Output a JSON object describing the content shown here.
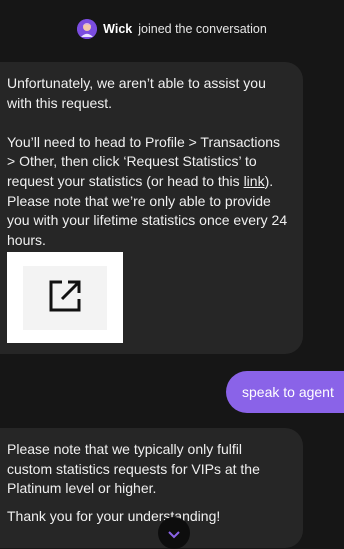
{
  "system_message": {
    "name": "Wick",
    "text": "joined the conversation",
    "avatar_icon": "agent-avatar-icon",
    "avatar_color": "#7b4de0"
  },
  "messages": {
    "bot_reply_1": {
      "para1": "Unfortunately, we aren’t able to assist you with this request.",
      "para2_prefix": "You’ll need to head to Profile > Transactions > Other, then click ‘Request Statistics’ to request your statistics (or head to this ",
      "para2_link": "link",
      "para2_suffix": "). Please note that we’re only able to provide you with your lifetime statistics once every 24 hours.",
      "preview_icon": "external-link-icon"
    },
    "user_message": {
      "text": "speak to agent",
      "color": "#8a63e8"
    },
    "bot_reply_2": {
      "para1": "Please note that we typically only fulfil custom statistics requests for VIPs at the Platinum level or higher.",
      "para2": "Thank you for your understanding!"
    }
  },
  "scroll_button": {
    "icon": "chevron-down-icon"
  },
  "colors": {
    "background": "#161616",
    "bubble": "#262626",
    "accent": "#8a63e8"
  }
}
